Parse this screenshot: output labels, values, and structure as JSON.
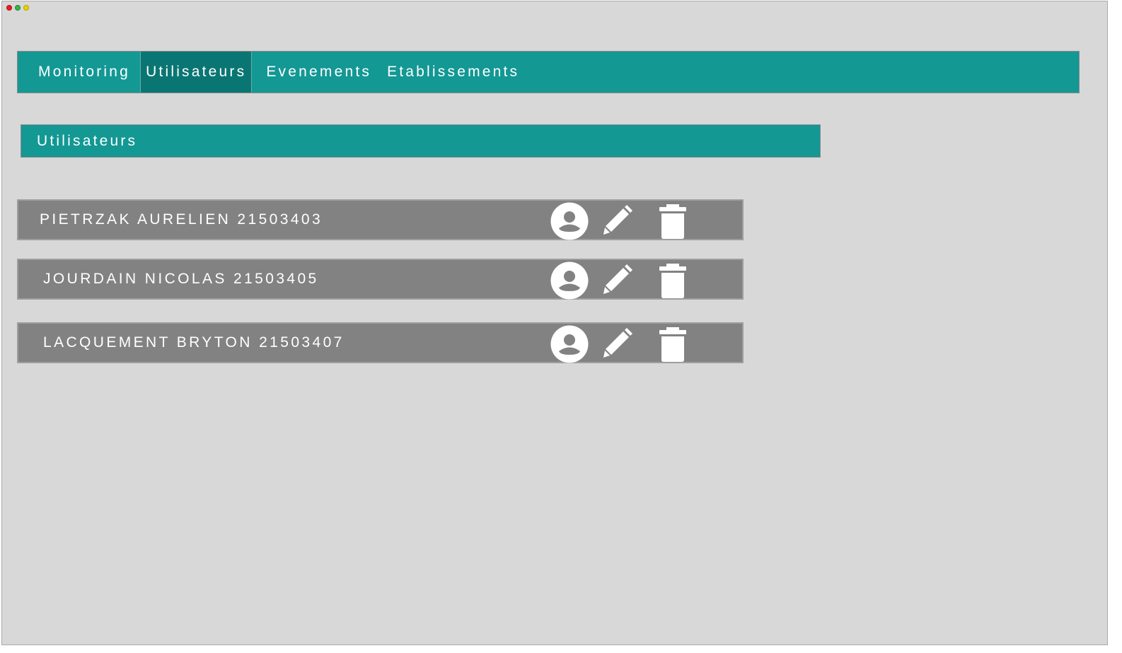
{
  "nav": {
    "tabs": [
      {
        "label": "Monitoring",
        "active": false
      },
      {
        "label": "Utilisateurs",
        "active": true
      },
      {
        "label": "Evenements",
        "active": false
      },
      {
        "label": "Etablissements",
        "active": false
      }
    ]
  },
  "section": {
    "title": "Utilisateurs"
  },
  "users": [
    {
      "label": "PIETRZAK AURELIEN 21503403"
    },
    {
      "label": "JOURDAIN NICOLAS 21503405"
    },
    {
      "label": "LACQUEMENT BRYTON 21503407"
    }
  ],
  "icons": {
    "profile": "account-circle-icon",
    "edit": "pencil-icon",
    "delete": "trash-icon"
  },
  "colors": {
    "nav_bg": "#139894",
    "nav_active_bg": "#0a7673",
    "row_bg": "#828282",
    "window_bg": "#d8d8d8"
  }
}
